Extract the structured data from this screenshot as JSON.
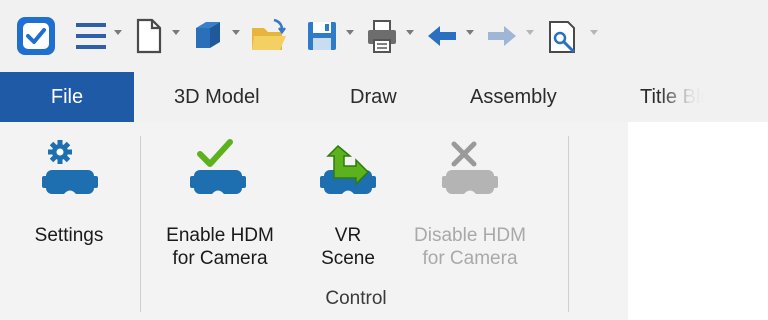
{
  "quick_access_toolbar": {
    "icons": [
      "app-logo-icon",
      "menu-icon",
      "new-document-icon",
      "3d-box-icon",
      "open-folder-icon",
      "save-icon",
      "print-icon",
      "undo-icon",
      "redo-icon",
      "properties-icon",
      "customize-icon"
    ],
    "accent": "#1f6fd1"
  },
  "tabs": [
    {
      "label": "File"
    },
    {
      "label": "3D Model"
    },
    {
      "label": "Draw"
    },
    {
      "label": "Assembly"
    },
    {
      "label": "Title Block"
    }
  ],
  "ribbon": {
    "settings": {
      "label": "Settings",
      "icon": "settings-vr-headset-icon"
    },
    "enable_hdm": {
      "label_line1": "Enable HDM",
      "label_line2": "for Camera",
      "icon": "enable-hdm-icon"
    },
    "vr_scene": {
      "label_line1": "VR",
      "label_line2": "Scene",
      "icon": "vr-scene-icon"
    },
    "disable_hdm": {
      "label_line1": "Disable HDM",
      "label_line2": "for Camera",
      "icon": "disable-hdm-icon",
      "enabled": false
    },
    "group_label": "Control"
  },
  "colors": {
    "file_tab_bg": "#1f5aa6",
    "headset_blue": "#1e6fb0",
    "check_green": "#5cb21d",
    "disabled_gray": "#a9a9a9"
  }
}
